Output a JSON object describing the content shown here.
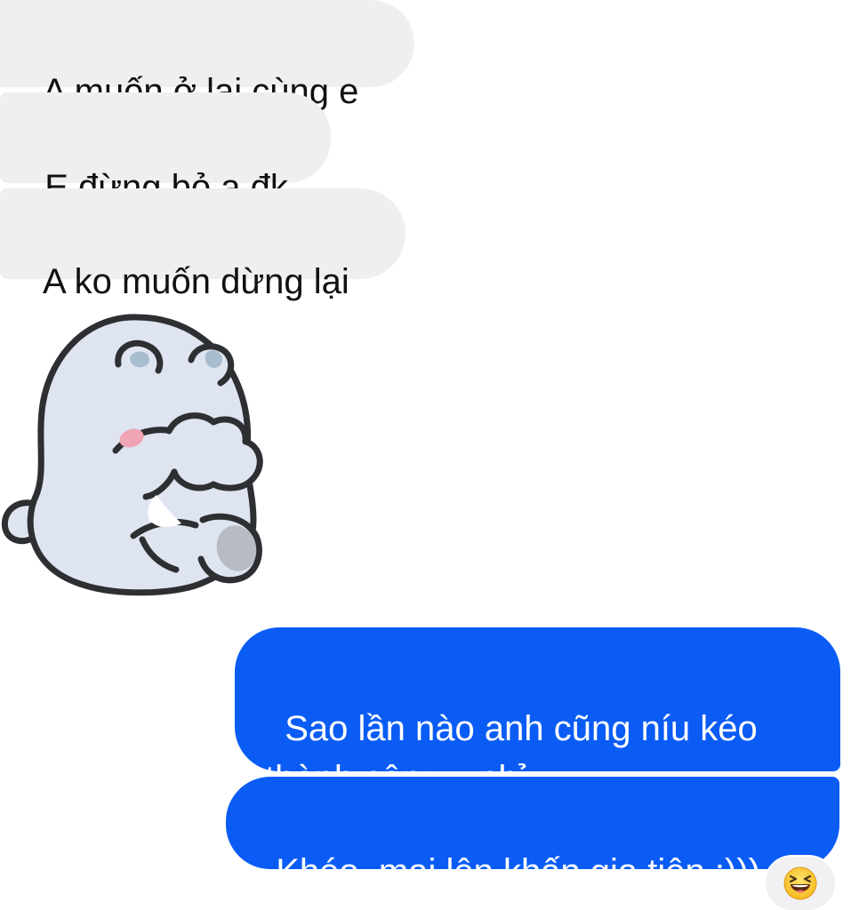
{
  "conversation": {
    "incoming_messages": [
      "A muốn ở lại cùng e",
      "E đừng bỏ a đk",
      "A ko muốn dừng lại"
    ],
    "sticker": {
      "icon": "bear-covering-mouth-sticker"
    },
    "outgoing_messages": [
      "Sao lần nào anh cũng níu kéo\nthành công v nhỉ",
      "Khéo  mai lên khấn gia tiên :)))"
    ],
    "reaction": {
      "icon": "laughing-squinting-face-emoji"
    }
  },
  "colors": {
    "incoming_bubble": "#efeff2",
    "outgoing_bubble": "#0a5cf5",
    "background": "#ffffff"
  }
}
